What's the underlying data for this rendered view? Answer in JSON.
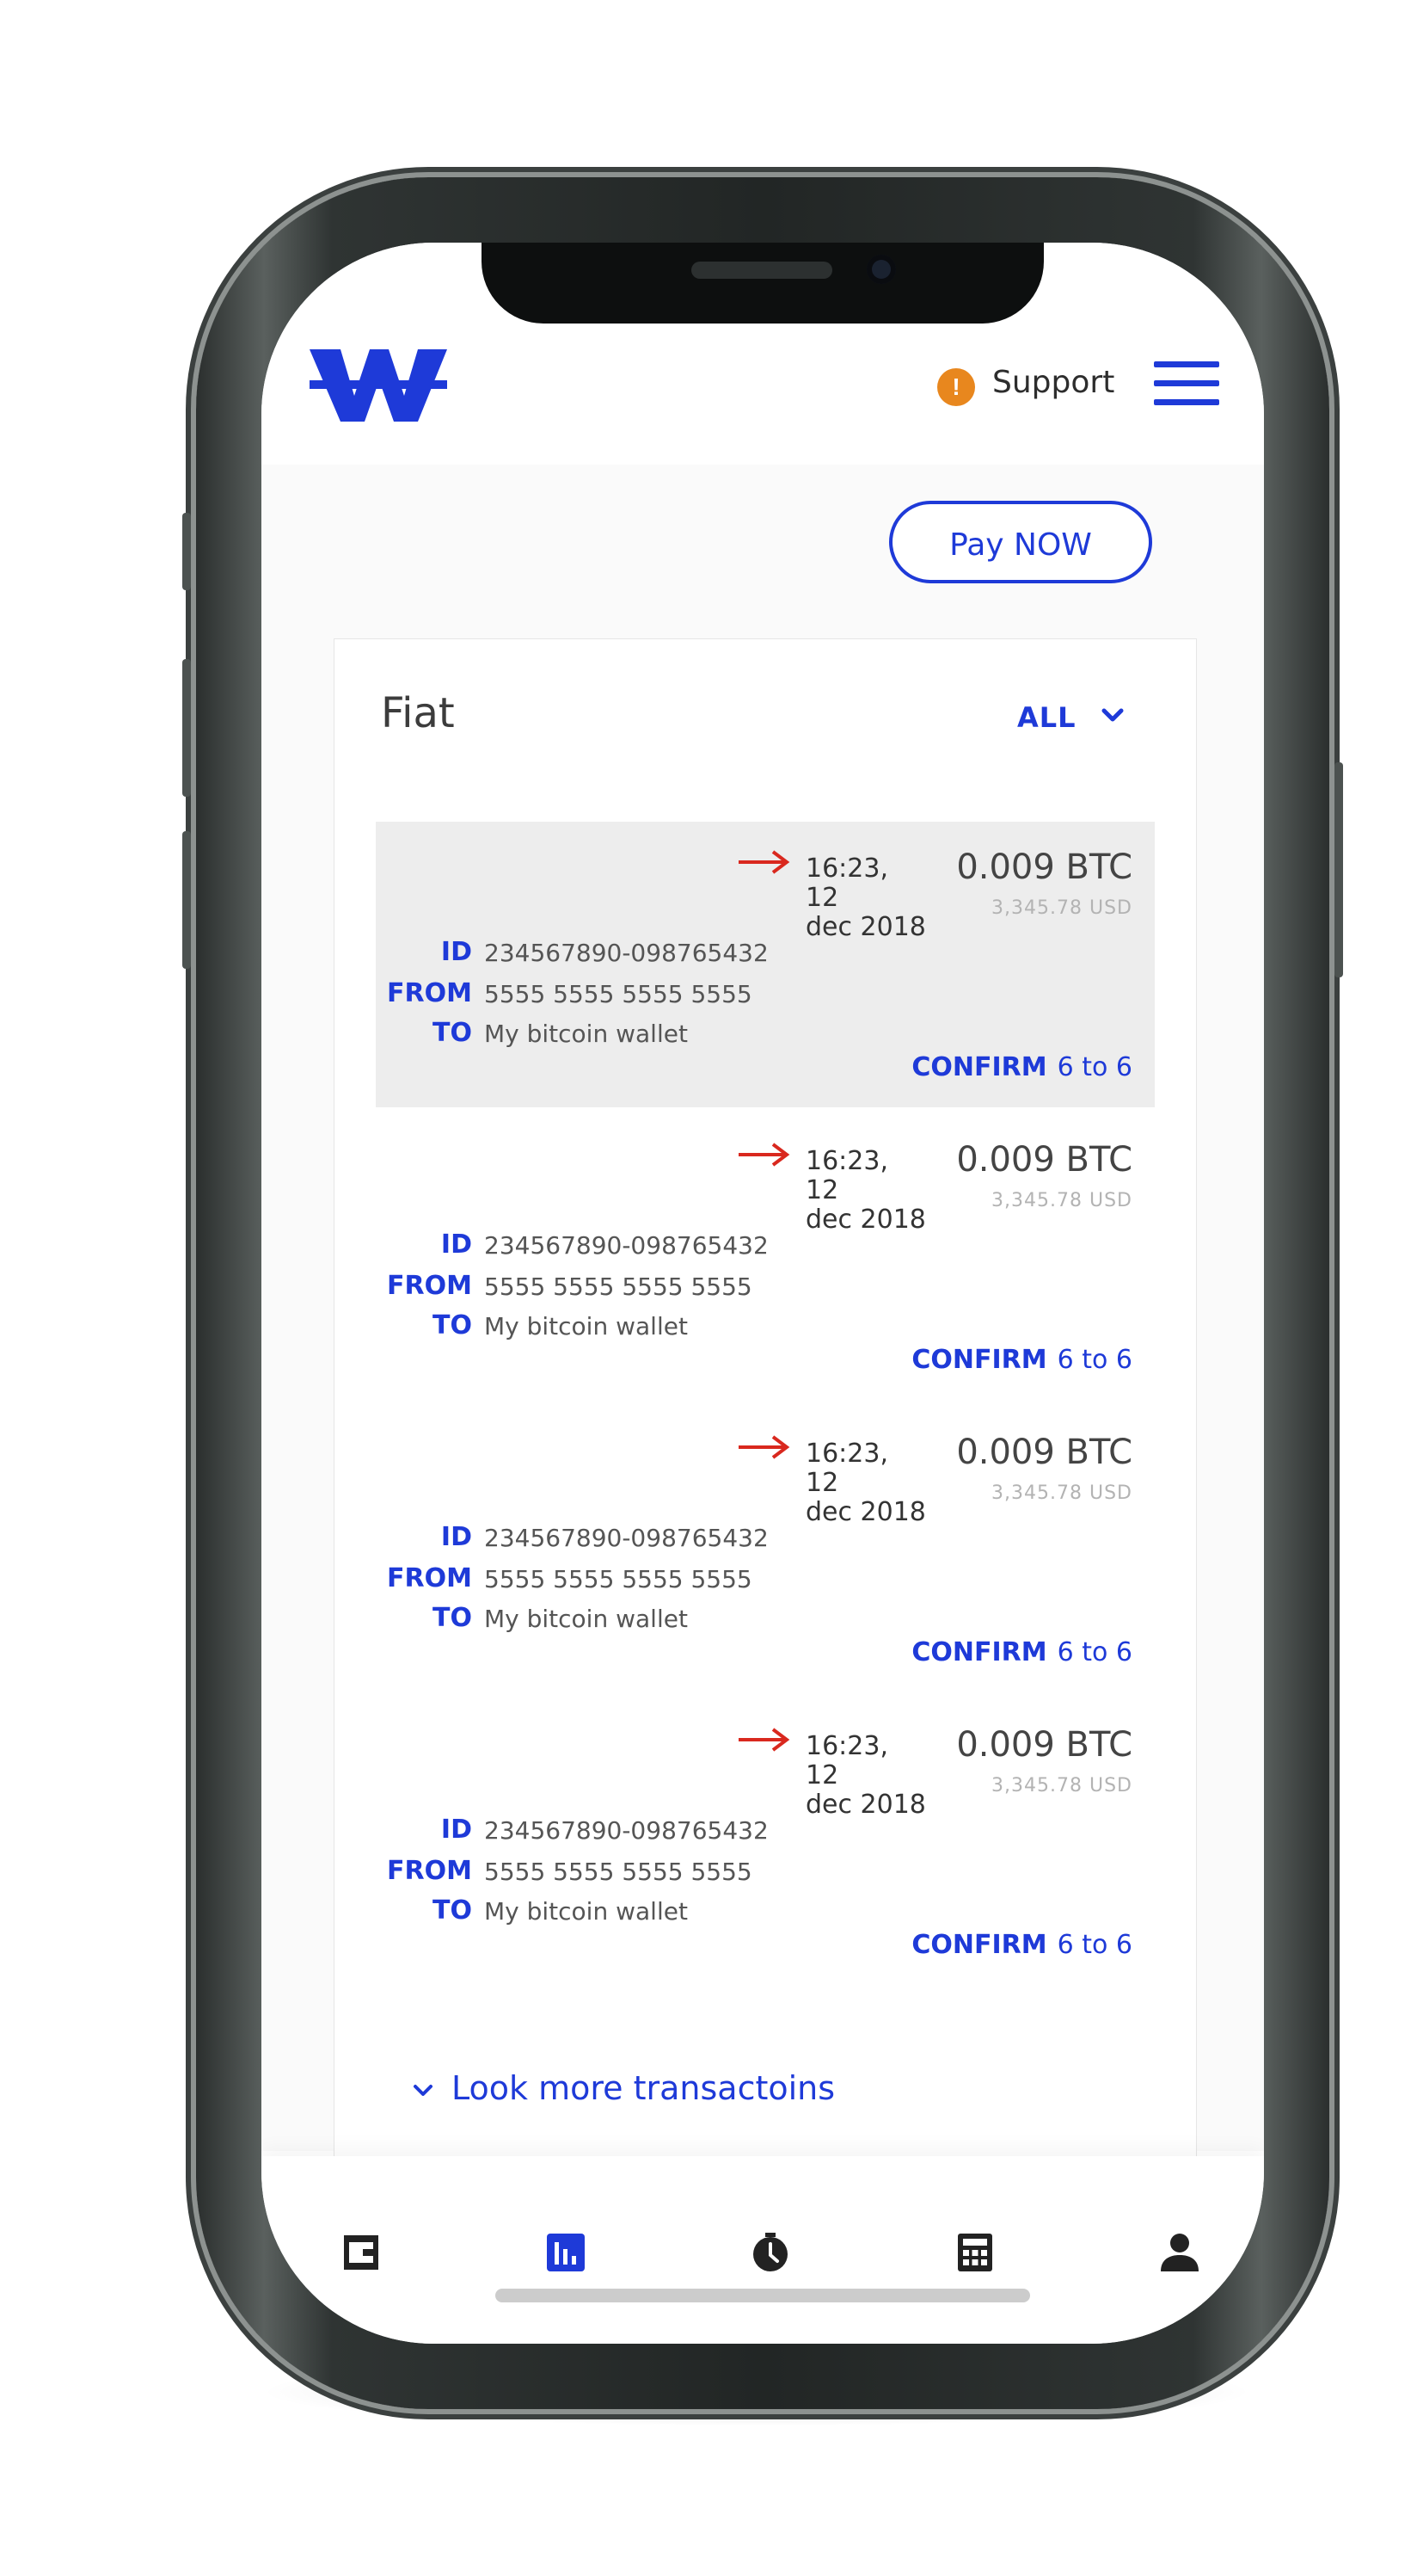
{
  "header": {
    "logo_icon": "w-logo-icon",
    "support_icon": "!",
    "support_label": "Support",
    "menu_icon": "hamburger-menu-icon"
  },
  "actions": {
    "pay_label": "Pay NOW"
  },
  "card": {
    "title": "Fiat",
    "filter_label": "ALL",
    "transactions": [
      {
        "time_line1": "16:23, 12",
        "time_line2": "dec 2018",
        "amount_btc": "0.009 BTC",
        "amount_usd": "3,345.78 USD",
        "id_key": "ID",
        "id_val": "234567890-098765432",
        "from_key": "FROM",
        "from_val": "5555 5555 5555 5555",
        "to_key": "TO",
        "to_val": "My bitcoin wallet",
        "confirm_label": "CONFIRM",
        "confirm_count": "6 to 6",
        "highlighted": true
      },
      {
        "time_line1": "16:23, 12",
        "time_line2": "dec 2018",
        "amount_btc": "0.009 BTC",
        "amount_usd": "3,345.78 USD",
        "id_key": "ID",
        "id_val": "234567890-098765432",
        "from_key": "FROM",
        "from_val": "5555 5555 5555 5555",
        "to_key": "TO",
        "to_val": "My bitcoin wallet",
        "confirm_label": "CONFIRM",
        "confirm_count": "6 to 6",
        "highlighted": false
      },
      {
        "time_line1": "16:23, 12",
        "time_line2": "dec 2018",
        "amount_btc": "0.009 BTC",
        "amount_usd": "3,345.78 USD",
        "id_key": "ID",
        "id_val": "234567890-098765432",
        "from_key": "FROM",
        "from_val": "5555 5555 5555 5555",
        "to_key": "TO",
        "to_val": "My bitcoin wallet",
        "confirm_label": "CONFIRM",
        "confirm_count": "6 to 6",
        "highlighted": false
      },
      {
        "time_line1": "16:23, 12",
        "time_line2": "dec 2018",
        "amount_btc": "0.009 BTC",
        "amount_usd": "3,345.78 USD",
        "id_key": "ID",
        "id_val": "234567890-098765432",
        "from_key": "FROM",
        "from_val": "5555 5555 5555 5555",
        "to_key": "TO",
        "to_val": "My bitcoin wallet",
        "confirm_label": "CONFIRM",
        "confirm_count": "6 to 6",
        "highlighted": false
      }
    ],
    "more_label": "Look more transactoins"
  },
  "tabbar": {
    "tabs": [
      {
        "icon": "wallet-icon",
        "active": false
      },
      {
        "icon": "bar-chart-icon",
        "active": true
      },
      {
        "icon": "history-clock-icon",
        "active": false
      },
      {
        "icon": "calculator-icon",
        "active": false
      },
      {
        "icon": "profile-icon",
        "active": false
      }
    ]
  },
  "colors": {
    "accent": "#1e3ad8",
    "arrow": "#d9281e",
    "support": "#e8871e",
    "highlight_bg": "#ededed",
    "tab_icon": "#222222"
  }
}
